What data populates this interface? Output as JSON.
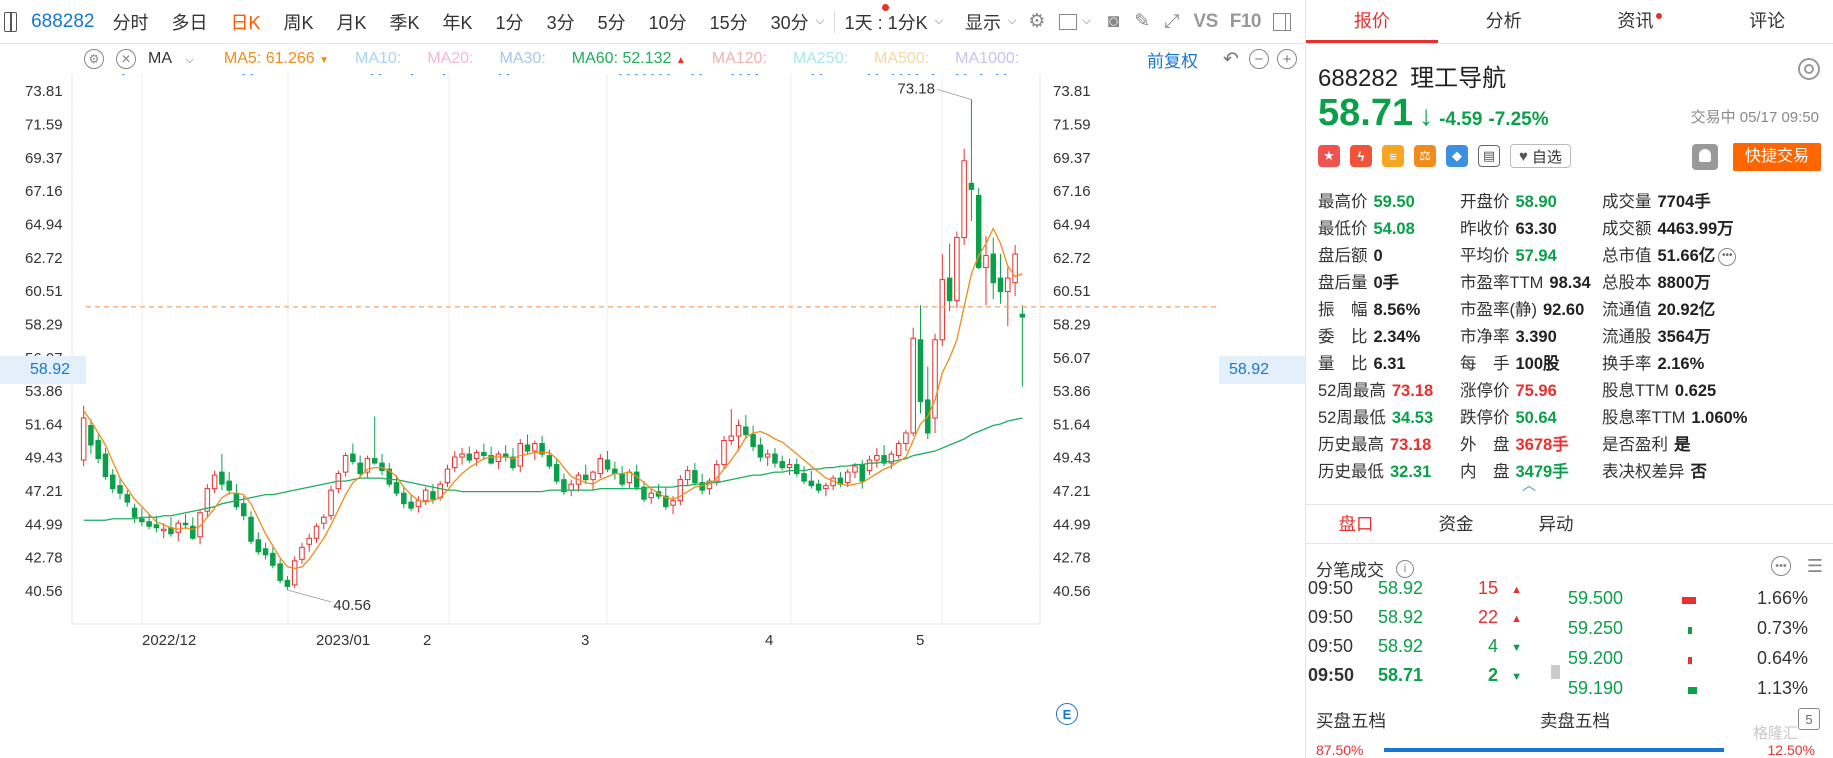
{
  "toolbar": {
    "code": "688282",
    "timeframes": [
      "分时",
      "多日",
      "日K",
      "周K",
      "月K",
      "季K",
      "年K",
      "1分",
      "3分",
      "5分",
      "10分",
      "15分",
      "30分"
    ],
    "active_timeframe": "日K",
    "range_label": "1天 : 1分K",
    "display_label": "显示",
    "vs_label": "VS",
    "f10_label": "F10"
  },
  "indicators": {
    "ma_select": "MA",
    "ma5": "MA5: 61.266",
    "ma10": "MA10:",
    "ma20": "MA20:",
    "ma30": "MA30:",
    "ma60": "MA60: 52.132",
    "ma120": "MA120:",
    "ma250": "MA250:",
    "ma500": "MA500:",
    "ma1000": "MA1000:",
    "adjust": "前复权"
  },
  "chart_data": {
    "type": "candlestick",
    "y_ticks": [
      "73.81",
      "71.59",
      "69.37",
      "67.16",
      "64.94",
      "62.72",
      "60.51",
      "58.29",
      "56.07",
      "53.86",
      "51.64",
      "49.43",
      "47.21",
      "44.99",
      "42.78",
      "40.56"
    ],
    "x_ticks": [
      "2022/12",
      "2023/01",
      "2",
      "3",
      "4",
      "5"
    ],
    "current_price_label": "58.92",
    "high_label": "73.18",
    "low_label": "40.56",
    "ohlc": [
      [
        49.2,
        52.8,
        48.8,
        52.0
      ],
      [
        51.5,
        51.9,
        49.6,
        50.2
      ],
      [
        50.5,
        50.9,
        49.0,
        49.3
      ],
      [
        49.6,
        50.0,
        47.9,
        48.1
      ],
      [
        48.2,
        48.6,
        47.0,
        47.3
      ],
      [
        47.5,
        48.0,
        46.6,
        47.0
      ],
      [
        46.9,
        47.2,
        46.1,
        46.4
      ],
      [
        46.0,
        46.3,
        45.0,
        45.4
      ],
      [
        45.3,
        46.0,
        44.8,
        45.1
      ],
      [
        45.1,
        45.6,
        44.6,
        44.8
      ],
      [
        44.9,
        45.5,
        44.4,
        44.7
      ],
      [
        44.5,
        45.0,
        44.0,
        44.6
      ],
      [
        44.7,
        45.4,
        44.1,
        44.3
      ],
      [
        44.4,
        45.2,
        43.8,
        45.0
      ],
      [
        45.0,
        45.6,
        44.6,
        44.9
      ],
      [
        44.8,
        45.4,
        43.9,
        44.0
      ],
      [
        44.1,
        45.9,
        43.6,
        45.7
      ],
      [
        45.8,
        47.6,
        45.4,
        47.3
      ],
      [
        47.3,
        48.5,
        47.0,
        48.2
      ],
      [
        48.4,
        49.6,
        47.2,
        47.6
      ],
      [
        47.8,
        48.4,
        46.9,
        47.2
      ],
      [
        47.0,
        47.6,
        45.9,
        46.1
      ],
      [
        46.3,
        46.8,
        45.2,
        45.5
      ],
      [
        45.4,
        45.8,
        43.6,
        43.8
      ],
      [
        43.9,
        44.4,
        42.9,
        43.1
      ],
      [
        43.3,
        43.7,
        42.6,
        42.9
      ],
      [
        43.0,
        43.4,
        42.0,
        42.2
      ],
      [
        42.3,
        42.6,
        41.0,
        41.2
      ],
      [
        41.2,
        41.5,
        40.56,
        40.8
      ],
      [
        40.9,
        42.8,
        40.7,
        42.5
      ],
      [
        42.6,
        43.7,
        42.3,
        43.4
      ],
      [
        43.6,
        44.3,
        43.1,
        44.0
      ],
      [
        44.0,
        45.0,
        43.7,
        44.8
      ],
      [
        45.0,
        45.6,
        44.6,
        45.4
      ],
      [
        45.5,
        47.5,
        45.2,
        47.2
      ],
      [
        47.3,
        48.5,
        47.0,
        48.3
      ],
      [
        48.4,
        49.7,
        48.1,
        49.5
      ],
      [
        49.6,
        50.3,
        48.9,
        49.1
      ],
      [
        49.0,
        49.5,
        48.1,
        48.3
      ],
      [
        48.4,
        49.5,
        48.0,
        49.3
      ],
      [
        49.3,
        52.1,
        48.9,
        49.0
      ],
      [
        49.0,
        49.6,
        48.2,
        48.5
      ],
      [
        48.6,
        49.0,
        47.4,
        47.6
      ],
      [
        47.7,
        48.2,
        46.8,
        47.0
      ],
      [
        47.0,
        47.5,
        46.0,
        46.3
      ],
      [
        46.4,
        46.9,
        45.8,
        46.0
      ],
      [
        46.1,
        46.8,
        45.7,
        46.5
      ],
      [
        46.5,
        47.4,
        46.2,
        47.2
      ],
      [
        47.1,
        47.6,
        46.3,
        46.6
      ],
      [
        46.7,
        47.8,
        46.5,
        47.6
      ],
      [
        47.7,
        48.9,
        47.4,
        48.6
      ],
      [
        48.7,
        49.8,
        48.4,
        49.4
      ],
      [
        49.4,
        50.0,
        48.9,
        49.6
      ],
      [
        49.6,
        50.1,
        49.0,
        49.2
      ],
      [
        49.3,
        49.9,
        48.8,
        49.7
      ],
      [
        49.7,
        50.3,
        49.2,
        49.5
      ],
      [
        49.5,
        50.1,
        48.9,
        49.0
      ],
      [
        49.1,
        49.8,
        48.6,
        49.6
      ],
      [
        49.6,
        50.2,
        49.1,
        49.4
      ],
      [
        49.4,
        50.0,
        48.5,
        48.7
      ],
      [
        48.8,
        50.6,
        48.4,
        50.3
      ],
      [
        50.2,
        50.9,
        49.6,
        49.8
      ],
      [
        49.8,
        50.5,
        49.2,
        50.3
      ],
      [
        50.3,
        50.8,
        49.4,
        49.6
      ],
      [
        49.5,
        49.9,
        48.6,
        48.8
      ],
      [
        48.9,
        49.3,
        47.6,
        47.8
      ],
      [
        47.9,
        48.3,
        46.9,
        47.1
      ],
      [
        47.2,
        47.9,
        46.8,
        47.6
      ],
      [
        47.6,
        48.4,
        47.1,
        48.2
      ],
      [
        48.2,
        48.9,
        47.6,
        47.9
      ],
      [
        47.9,
        48.5,
        47.2,
        48.4
      ],
      [
        48.3,
        49.6,
        48.0,
        49.3
      ],
      [
        49.2,
        49.8,
        48.4,
        48.6
      ],
      [
        48.6,
        49.1,
        47.9,
        48.3
      ],
      [
        48.3,
        48.8,
        47.4,
        47.6
      ],
      [
        47.7,
        48.6,
        47.3,
        48.4
      ],
      [
        48.4,
        48.9,
        47.2,
        47.4
      ],
      [
        47.4,
        47.8,
        46.4,
        46.6
      ],
      [
        46.7,
        47.3,
        46.3,
        47.0
      ],
      [
        47.1,
        47.6,
        46.6,
        46.8
      ],
      [
        46.8,
        47.4,
        45.9,
        46.1
      ],
      [
        46.2,
        46.8,
        45.6,
        46.5
      ],
      [
        46.5,
        48.2,
        46.2,
        47.9
      ],
      [
        47.9,
        48.8,
        47.5,
        48.5
      ],
      [
        48.5,
        49.0,
        47.5,
        47.7
      ],
      [
        47.7,
        48.3,
        46.9,
        47.2
      ],
      [
        47.3,
        48.0,
        46.9,
        47.8
      ],
      [
        47.8,
        49.2,
        47.5,
        48.9
      ],
      [
        48.9,
        50.8,
        48.6,
        50.5
      ],
      [
        50.5,
        52.6,
        50.2,
        50.8
      ],
      [
        50.8,
        51.9,
        49.8,
        51.5
      ],
      [
        51.4,
        52.2,
        50.6,
        50.9
      ],
      [
        50.9,
        51.5,
        49.8,
        50.1
      ],
      [
        50.2,
        50.7,
        49.1,
        49.4
      ],
      [
        49.4,
        49.9,
        48.8,
        49.6
      ],
      [
        49.6,
        50.0,
        48.7,
        49.0
      ],
      [
        49.1,
        49.5,
        48.5,
        48.7
      ],
      [
        48.7,
        49.3,
        48.2,
        48.9
      ],
      [
        48.9,
        49.3,
        48.1,
        48.3
      ],
      [
        48.3,
        48.8,
        47.6,
        47.8
      ],
      [
        47.8,
        48.5,
        47.3,
        47.5
      ],
      [
        47.6,
        47.9,
        47.0,
        47.2
      ],
      [
        47.3,
        47.7,
        46.8,
        47.5
      ],
      [
        47.5,
        48.2,
        47.2,
        48.0
      ],
      [
        48.0,
        48.4,
        47.4,
        47.6
      ],
      [
        47.7,
        48.6,
        47.4,
        48.4
      ],
      [
        48.4,
        49.0,
        48.0,
        48.8
      ],
      [
        48.9,
        49.2,
        47.3,
        47.8
      ],
      [
        48.5,
        49.5,
        48.2,
        49.2
      ],
      [
        49.2,
        50.0,
        48.7,
        49.5
      ],
      [
        49.5,
        50.2,
        48.8,
        49.0
      ],
      [
        49.0,
        49.8,
        48.6,
        49.6
      ],
      [
        49.5,
        50.5,
        49.3,
        50.3
      ],
      [
        50.3,
        51.2,
        49.8,
        51.0
      ],
      [
        51.0,
        58.0,
        50.8,
        57.3
      ],
      [
        57.2,
        59.5,
        52.3,
        53.1
      ],
      [
        53.2,
        55.4,
        50.6,
        51.0
      ],
      [
        52.0,
        57.6,
        51.0,
        57.2
      ],
      [
        57.2,
        62.9,
        56.8,
        61.2
      ],
      [
        61.3,
        63.6,
        59.1,
        59.8
      ],
      [
        59.8,
        64.4,
        59.3,
        64.0
      ],
      [
        64.0,
        69.9,
        63.5,
        69.1
      ],
      [
        67.6,
        73.18,
        65.1,
        67.2
      ],
      [
        66.8,
        67.3,
        61.9,
        62.0
      ],
      [
        62.0,
        64.1,
        59.5,
        62.8
      ],
      [
        62.9,
        64.0,
        59.9,
        61.0
      ],
      [
        61.3,
        62.9,
        59.6,
        60.4
      ],
      [
        60.4,
        62.0,
        58.1,
        61.3
      ],
      [
        61.0,
        63.5,
        60.1,
        62.9
      ],
      [
        58.9,
        59.5,
        54.08,
        58.71
      ]
    ],
    "ma5": [
      52.5,
      51.8,
      51.0,
      50.2,
      49.1,
      48.0,
      47.3,
      46.6,
      46.1,
      45.6,
      45.1,
      44.9,
      44.7,
      44.6,
      44.7,
      44.6,
      44.8,
      45.4,
      46.0,
      46.7,
      47.0,
      47.0,
      46.9,
      46.3,
      45.3,
      44.3,
      43.5,
      42.7,
      42.1,
      42.0,
      42.1,
      42.6,
      43.3,
      44.0,
      44.9,
      45.9,
      46.9,
      47.7,
      48.1,
      48.6,
      48.7,
      48.7,
      48.5,
      48.1,
      47.4,
      46.9,
      46.5,
      46.4,
      46.5,
      46.7,
      47.2,
      47.8,
      48.3,
      48.7,
      49.0,
      49.3,
      49.4,
      49.4,
      49.4,
      49.3,
      49.5,
      49.6,
      49.7,
      49.7,
      49.7,
      49.3,
      48.7,
      48.1,
      47.9,
      47.7,
      47.6,
      47.9,
      48.1,
      48.3,
      48.3,
      48.4,
      48.1,
      47.7,
      47.3,
      47.0,
      46.7,
      46.6,
      46.8,
      47.1,
      47.4,
      47.5,
      47.6,
      48.0,
      48.6,
      49.2,
      49.9,
      50.7,
      51.0,
      51.1,
      50.9,
      50.6,
      50.4,
      50.0,
      49.6,
      49.2,
      48.8,
      48.4,
      48.0,
      47.8,
      47.6,
      47.5,
      47.6,
      47.7,
      48.0,
      48.3,
      48.6,
      48.8,
      49.1,
      49.4,
      50.5,
      51.6,
      52.1,
      53.2,
      55.0,
      56.0,
      57.2,
      59.4,
      61.6,
      62.8,
      63.6,
      64.6,
      63.6,
      62.1,
      61.4,
      61.6,
      61.2,
      60.9,
      60.8,
      61.3,
      61.266
    ],
    "ma60": [
      45.2,
      45.2,
      45.2,
      45.2,
      45.3,
      45.3,
      45.3,
      45.3,
      45.4,
      45.4,
      45.4,
      45.5,
      45.5,
      45.6,
      45.7,
      45.8,
      45.9,
      46.0,
      46.1,
      46.3,
      46.4,
      46.5,
      46.6,
      46.7,
      46.8,
      46.9,
      46.9,
      47.0,
      47.1,
      47.2,
      47.3,
      47.4,
      47.5,
      47.6,
      47.7,
      47.8,
      47.8,
      47.9,
      48.0,
      48.0,
      48.0,
      48.0,
      47.9,
      47.9,
      47.8,
      47.7,
      47.6,
      47.5,
      47.4,
      47.3,
      47.2,
      47.2,
      47.1,
      47.1,
      47.1,
      47.1,
      47.1,
      47.1,
      47.1,
      47.1,
      47.1,
      47.1,
      47.1,
      47.1,
      47.2,
      47.2,
      47.2,
      47.2,
      47.2,
      47.2,
      47.2,
      47.3,
      47.3,
      47.3,
      47.3,
      47.3,
      47.3,
      47.3,
      47.4,
      47.4,
      47.4,
      47.4,
      47.5,
      47.5,
      47.6,
      47.6,
      47.7,
      47.7,
      47.8,
      47.9,
      48.0,
      48.1,
      48.2,
      48.2,
      48.3,
      48.4,
      48.4,
      48.5,
      48.5,
      48.5,
      48.6,
      48.6,
      48.7,
      48.7,
      48.8,
      48.8,
      48.9,
      48.9,
      49.0,
      49.0,
      49.1,
      49.1,
      49.2,
      49.3,
      49.5,
      49.6,
      49.7,
      49.8,
      50.0,
      50.2,
      50.4,
      50.6,
      50.9,
      51.1,
      51.3,
      51.5,
      51.6,
      51.8,
      51.9,
      52.0,
      52.132,
      52.2,
      52.3,
      52.4,
      52.5
    ]
  },
  "right_panel": {
    "tabs": [
      "报价",
      "分析",
      "资讯",
      "评论"
    ],
    "code": "688282",
    "name": "理工导航",
    "price": "58.71",
    "arrow": "↓",
    "change": "-4.59",
    "change_pct": "-7.25%",
    "status": "交易中 05/17 09:50",
    "zixuan": "自选",
    "quick_trade": "快捷交易",
    "stats": [
      [
        {
          "l": "最高价",
          "v": "59.50",
          "c": "green"
        },
        {
          "l": "开盘价",
          "v": "58.90",
          "c": "green"
        },
        {
          "l": "成交量",
          "v": "7704手",
          "c": "dark"
        }
      ],
      [
        {
          "l": "最低价",
          "v": "54.08",
          "c": "green"
        },
        {
          "l": "昨收价",
          "v": "63.30",
          "c": "dark"
        },
        {
          "l": "成交额",
          "v": "4463.99万",
          "c": "dark"
        }
      ],
      [
        {
          "l": "盘后额",
          "v": "0",
          "c": "dark"
        },
        {
          "l": "平均价",
          "v": "57.94",
          "c": "green"
        },
        {
          "l": "总市值",
          "v": "51.66亿",
          "c": "dark"
        }
      ],
      [
        {
          "l": "盘后量",
          "v": "0手",
          "c": "dark"
        },
        {
          "l": "市盈率TTM",
          "v": "98.34",
          "c": "dark"
        },
        {
          "l": "总股本",
          "v": "8800万",
          "c": "dark"
        }
      ],
      [
        {
          "l": "振　幅",
          "v": "8.56%",
          "c": "dark"
        },
        {
          "l": "市盈率(静)",
          "v": "92.60",
          "c": "dark"
        },
        {
          "l": "流通值",
          "v": "20.92亿",
          "c": "dark"
        }
      ],
      [
        {
          "l": "委　比",
          "v": "2.34%",
          "c": "dark"
        },
        {
          "l": "市净率",
          "v": "3.390",
          "c": "dark"
        },
        {
          "l": "流通股",
          "v": "3564万",
          "c": "dark"
        }
      ],
      [
        {
          "l": "量　比",
          "v": "6.31",
          "c": "dark"
        },
        {
          "l": "每　手",
          "v": "100股",
          "c": "dark"
        },
        {
          "l": "换手率",
          "v": "2.16%",
          "c": "dark"
        }
      ],
      [
        {
          "l": "52周最高",
          "v": "73.18",
          "c": "red"
        },
        {
          "l": "涨停价",
          "v": "75.96",
          "c": "red"
        },
        {
          "l": "股息TTM",
          "v": "0.625",
          "c": "dark"
        }
      ],
      [
        {
          "l": "52周最低",
          "v": "34.53",
          "c": "green"
        },
        {
          "l": "跌停价",
          "v": "50.64",
          "c": "green"
        },
        {
          "l": "股息率TTM",
          "v": "1.060%",
          "c": "dark"
        }
      ],
      [
        {
          "l": "历史最高",
          "v": "73.18",
          "c": "red"
        },
        {
          "l": "外　盘",
          "v": "3678手",
          "c": "red"
        },
        {
          "l": "是否盈利",
          "v": "是",
          "c": "dark"
        }
      ],
      [
        {
          "l": "历史最低",
          "v": "32.31",
          "c": "green"
        },
        {
          "l": "内　盘",
          "v": "3479手",
          "c": "green"
        },
        {
          "l": "表决权差异",
          "v": "否",
          "c": "dark"
        }
      ]
    ],
    "sub_tabs": [
      "盘口",
      "资金",
      "异动"
    ],
    "fenbi_title": "分笔成交",
    "ticks": [
      {
        "t": "09:50",
        "p": "58.92",
        "v": "15",
        "dir": "up"
      },
      {
        "t": "09:50",
        "p": "58.92",
        "v": "22",
        "dir": "up"
      },
      {
        "t": "09:50",
        "p": "58.92",
        "v": "4",
        "dir": "down"
      },
      {
        "t": "09:50",
        "p": "58.71",
        "v": "2",
        "dir": "down"
      }
    ],
    "orderbook": [
      {
        "p": "59.500",
        "pct": "1.66%",
        "bar": "red",
        "fill": 0.8
      },
      {
        "p": "59.250",
        "pct": "0.73%",
        "bar": "green",
        "fill": 0.1
      },
      {
        "p": "59.200",
        "pct": "0.64%",
        "bar": "red",
        "fill": 0.1
      },
      {
        "p": "59.190",
        "pct": "1.13%",
        "bar": "green",
        "fill": 0.5
      }
    ],
    "buy5": "买盘五档",
    "sell5": "卖盘五档",
    "five": "5",
    "buy_pct": "87.50%",
    "sell_pct": "12.50%",
    "watermark": "格隆汇"
  }
}
